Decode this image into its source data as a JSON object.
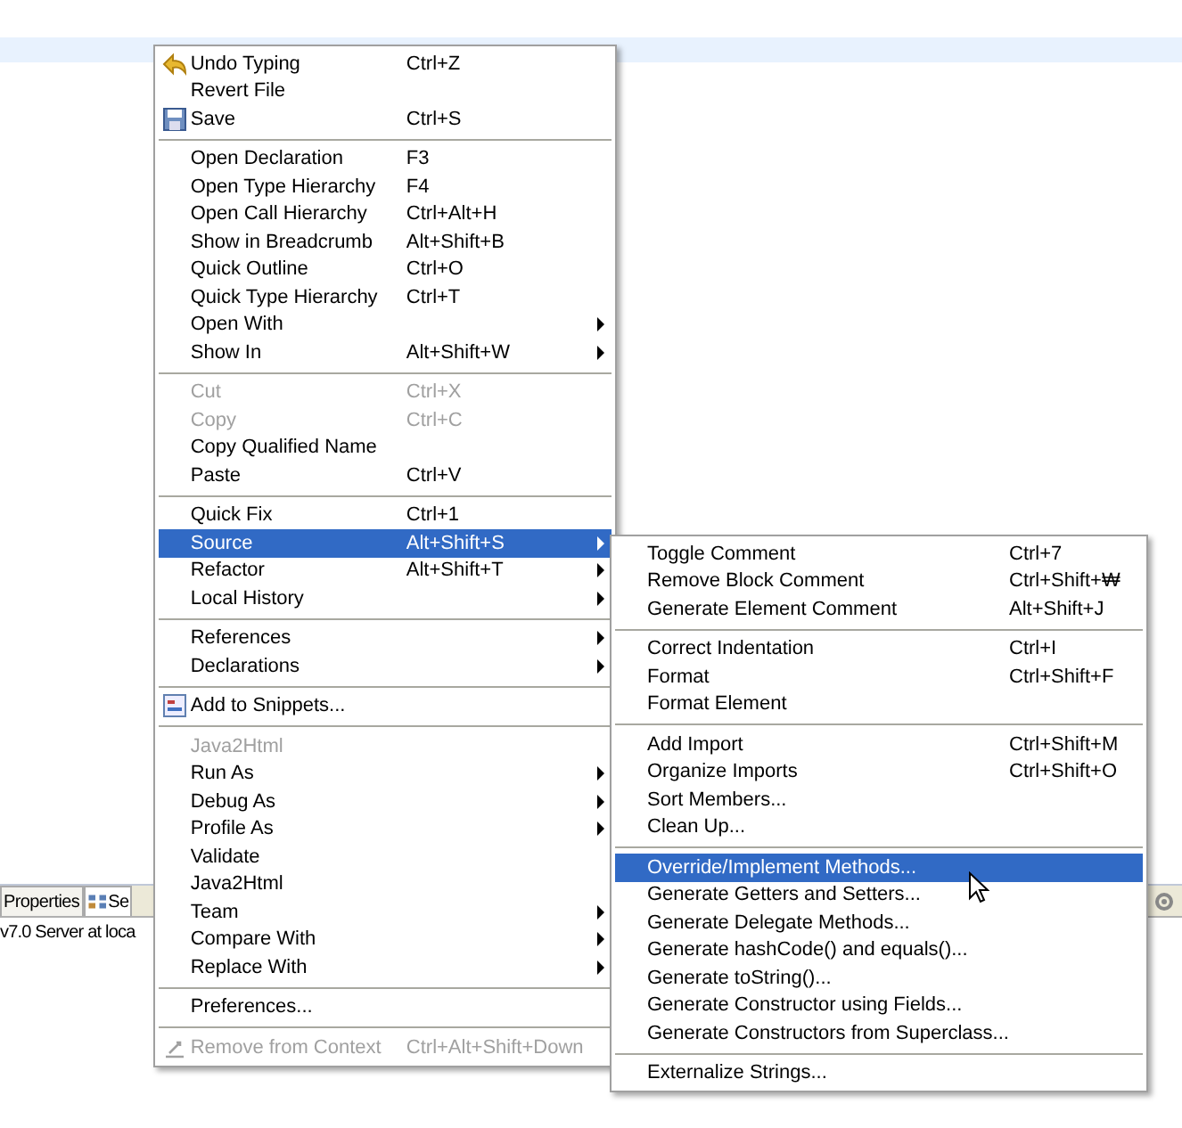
{
  "panel": {
    "tabs": [
      {
        "label": "Properties",
        "selected": false
      },
      {
        "label": "Se",
        "selected": true
      }
    ],
    "content": "v7.0 Server at loca"
  },
  "menu": {
    "items": [
      {
        "kind": "item",
        "label": "Undo Typing",
        "shortcut": "Ctrl+Z",
        "disabled": false,
        "submenu": false,
        "selected": false
      },
      {
        "kind": "item",
        "label": "Revert File",
        "disabled": false,
        "submenu": false,
        "selected": false
      },
      {
        "kind": "item",
        "label": "Save",
        "shortcut": "Ctrl+S",
        "disabled": false,
        "submenu": false,
        "selected": false
      },
      {
        "kind": "separator"
      },
      {
        "kind": "item",
        "label": "Open Declaration",
        "shortcut": "F3",
        "disabled": false,
        "submenu": false,
        "selected": false
      },
      {
        "kind": "item",
        "label": "Open Type Hierarchy",
        "shortcut": "F4",
        "disabled": false,
        "submenu": false,
        "selected": false
      },
      {
        "kind": "item",
        "label": "Open Call Hierarchy",
        "shortcut": "Ctrl+Alt+H",
        "disabled": false,
        "submenu": false,
        "selected": false
      },
      {
        "kind": "item",
        "label": "Show in Breadcrumb",
        "shortcut": "Alt+Shift+B",
        "disabled": false,
        "submenu": false,
        "selected": false
      },
      {
        "kind": "item",
        "label": "Quick Outline",
        "shortcut": "Ctrl+O",
        "disabled": false,
        "submenu": false,
        "selected": false
      },
      {
        "kind": "item",
        "label": "Quick Type Hierarchy",
        "shortcut": "Ctrl+T",
        "disabled": false,
        "submenu": false,
        "selected": false
      },
      {
        "kind": "item",
        "label": "Open With",
        "disabled": false,
        "submenu": true,
        "selected": false
      },
      {
        "kind": "item",
        "label": "Show In",
        "shortcut": "Alt+Shift+W",
        "disabled": false,
        "submenu": true,
        "selected": false
      },
      {
        "kind": "separator"
      },
      {
        "kind": "item",
        "label": "Cut",
        "shortcut": "Ctrl+X",
        "disabled": true,
        "submenu": false,
        "selected": false
      },
      {
        "kind": "item",
        "label": "Copy",
        "shortcut": "Ctrl+C",
        "disabled": true,
        "submenu": false,
        "selected": false
      },
      {
        "kind": "item",
        "label": "Copy Qualified Name",
        "disabled": false,
        "submenu": false,
        "selected": false
      },
      {
        "kind": "item",
        "label": "Paste",
        "shortcut": "Ctrl+V",
        "disabled": false,
        "submenu": false,
        "selected": false
      },
      {
        "kind": "separator"
      },
      {
        "kind": "item",
        "label": "Quick Fix",
        "shortcut": "Ctrl+1",
        "disabled": false,
        "submenu": false,
        "selected": false
      },
      {
        "kind": "item",
        "label": "Source",
        "shortcut": "Alt+Shift+S",
        "disabled": false,
        "submenu": true,
        "selected": true
      },
      {
        "kind": "item",
        "label": "Refactor",
        "shortcut": "Alt+Shift+T",
        "disabled": false,
        "submenu": true,
        "selected": false
      },
      {
        "kind": "item",
        "label": "Local History",
        "disabled": false,
        "submenu": true,
        "selected": false
      },
      {
        "kind": "separator"
      },
      {
        "kind": "item",
        "label": "References",
        "disabled": false,
        "submenu": true,
        "selected": false
      },
      {
        "kind": "item",
        "label": "Declarations",
        "disabled": false,
        "submenu": true,
        "selected": false
      },
      {
        "kind": "separator"
      },
      {
        "kind": "item",
        "label": "Add to Snippets...",
        "disabled": false,
        "submenu": false,
        "selected": false
      },
      {
        "kind": "separator"
      },
      {
        "kind": "item",
        "label": "Java2Html",
        "disabled": true,
        "submenu": false,
        "selected": false
      },
      {
        "kind": "item",
        "label": "Run As",
        "disabled": false,
        "submenu": true,
        "selected": false
      },
      {
        "kind": "item",
        "label": "Debug As",
        "disabled": false,
        "submenu": true,
        "selected": false
      },
      {
        "kind": "item",
        "label": "Profile As",
        "disabled": false,
        "submenu": true,
        "selected": false
      },
      {
        "kind": "item",
        "label": "Validate",
        "disabled": false,
        "submenu": false,
        "selected": false
      },
      {
        "kind": "item",
        "label": "Java2Html",
        "disabled": false,
        "submenu": false,
        "selected": false
      },
      {
        "kind": "item",
        "label": "Team",
        "disabled": false,
        "submenu": true,
        "selected": false
      },
      {
        "kind": "item",
        "label": "Compare With",
        "disabled": false,
        "submenu": true,
        "selected": false
      },
      {
        "kind": "item",
        "label": "Replace With",
        "disabled": false,
        "submenu": true,
        "selected": false
      },
      {
        "kind": "separator"
      },
      {
        "kind": "item",
        "label": "Preferences...",
        "disabled": false,
        "submenu": false,
        "selected": false
      },
      {
        "kind": "separator"
      },
      {
        "kind": "item",
        "label": "Remove from Context",
        "shortcut": "Ctrl+Alt+Shift+Down",
        "disabled": true,
        "submenu": false,
        "selected": false
      }
    ]
  },
  "submenu": {
    "items": [
      {
        "kind": "item",
        "label": "Toggle Comment",
        "shortcut": "Ctrl+7",
        "selected": false
      },
      {
        "kind": "item",
        "label": "Remove Block Comment",
        "shortcut": "Ctrl+Shift+₩",
        "selected": false
      },
      {
        "kind": "item",
        "label": "Generate Element Comment",
        "shortcut": "Alt+Shift+J",
        "selected": false
      },
      {
        "kind": "separator"
      },
      {
        "kind": "item",
        "label": "Correct Indentation",
        "shortcut": "Ctrl+I",
        "selected": false
      },
      {
        "kind": "item",
        "label": "Format",
        "shortcut": "Ctrl+Shift+F",
        "selected": false
      },
      {
        "kind": "item",
        "label": "Format Element",
        "selected": false
      },
      {
        "kind": "separator"
      },
      {
        "kind": "item",
        "label": "Add Import",
        "shortcut": "Ctrl+Shift+M",
        "selected": false
      },
      {
        "kind": "item",
        "label": "Organize Imports",
        "shortcut": "Ctrl+Shift+O",
        "selected": false
      },
      {
        "kind": "item",
        "label": "Sort Members...",
        "selected": false
      },
      {
        "kind": "item",
        "label": "Clean Up...",
        "selected": false
      },
      {
        "kind": "separator"
      },
      {
        "kind": "item",
        "label": "Override/Implement Methods...",
        "selected": true
      },
      {
        "kind": "item",
        "label": "Generate Getters and Setters...",
        "selected": false
      },
      {
        "kind": "item",
        "label": "Generate Delegate Methods...",
        "selected": false
      },
      {
        "kind": "item",
        "label": "Generate hashCode() and equals()...",
        "selected": false
      },
      {
        "kind": "item",
        "label": "Generate toString()...",
        "selected": false
      },
      {
        "kind": "item",
        "label": "Generate Constructor using Fields...",
        "selected": false
      },
      {
        "kind": "item",
        "label": "Generate Constructors from Superclass...",
        "selected": false
      },
      {
        "kind": "separator"
      },
      {
        "kind": "item",
        "label": "Externalize Strings...",
        "selected": false
      }
    ]
  }
}
